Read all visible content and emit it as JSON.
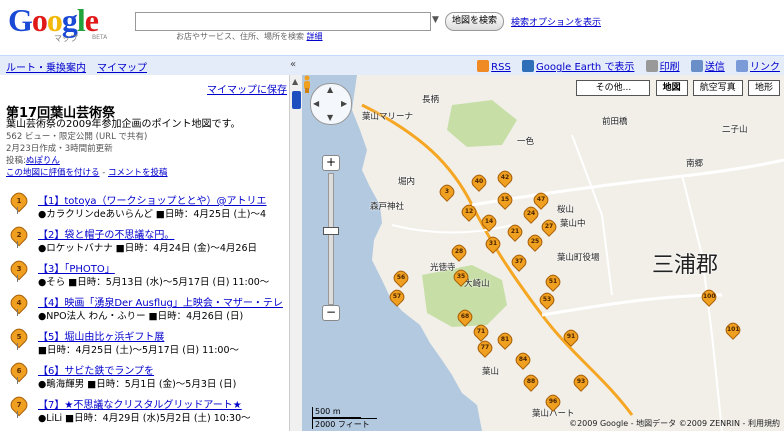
{
  "header": {
    "logo_text": "Google",
    "logo_sub": "マップ",
    "logo_beta": "BETA",
    "search_value": "",
    "search_button": "地図を検索",
    "search_options": "検索オプションを表示",
    "search_hint": "お店やサービス、住所、場所を検索",
    "search_hint_link": "詳細"
  },
  "topbar": {
    "tab_route": "ルート・乗換案内",
    "tab_mymaps": "マイマップ",
    "collapse_glyph": "«",
    "tools": {
      "rss": "RSS",
      "earth": "Google Earth で表示",
      "print": "印刷",
      "send": "送信",
      "link": "リンク"
    }
  },
  "sidebar": {
    "save_link": "マイマップに保存",
    "title": "第17回葉山芸術祭",
    "description": "葉山芸術祭の2009年参加企画のポイント地図です。",
    "stats": "562 ビュー・限定公開 (URL で共有)",
    "dates": "2月23日作成・3時間前更新",
    "author_label": "投稿:",
    "author": "ぬぽりん",
    "rate_link": "この地図に評価を付ける",
    "comment_link": "コメントを投稿",
    "comment_sep": " - ",
    "items": [
      {
        "num": "1",
        "title": "【1】totoya（ワークショップととや）@アトリエ",
        "detail": "●カラクリンdeあいらんど ■日時：4月25日 (土)〜4"
      },
      {
        "num": "2",
        "title": "【2】袋と帽子の不思議な円。",
        "detail": "●ロケットバナナ ■日時：4月24日 (金)〜4月26日"
      },
      {
        "num": "3",
        "title": "【3】「PHOTO」",
        "detail": "●そら ■日時：5月13日 (水)〜5月17日 (日) 11:00〜"
      },
      {
        "num": "4",
        "title": "【4】映画「湧泉Der Ausflug」上映会・マザー・テレ",
        "detail": "●NPO法人 わん・ふりー ■日時：4月26日 (日)"
      },
      {
        "num": "5",
        "title": "【5】堀山由比ヶ浜ギフト展",
        "detail": "■日時：4月25日 (土)〜5月17日 (日) 11:00〜"
      },
      {
        "num": "6",
        "title": "【6】サビた鉄でランプを",
        "detail": "●鴫海輝男 ■日時：5月1日 (金)〜5月3日 (日)"
      },
      {
        "num": "7",
        "title": "【7】★不思議なクリスタルグリッドアート★",
        "detail": "●LiLi ■日時：4月29日 (水)5月2日 (土) 10:30〜"
      }
    ]
  },
  "map": {
    "types": {
      "other": "その他...",
      "map": "地図",
      "aerial": "航空写真",
      "terrain": "地形"
    },
    "labels": {
      "miura": "三浦郡",
      "hayama": "葉山",
      "hayama_marina": "葉山マリーナ",
      "shrine": "森戸神社",
      "kojin": "光徳寺",
      "oosaki": "大崎山",
      "nagae": "長柄",
      "minamigo": "南郷",
      "sakurayama": "桜山",
      "hayama_jh": "葉山中",
      "town_office": "葉山町役場",
      "isshiki": "一色",
      "nisshiki": "二子山",
      "horiuchi": "堀内",
      "gate": "前田橋",
      "hayama_heart": "葉山ハート"
    },
    "pins": [
      "3",
      "12",
      "14",
      "15",
      "21",
      "24",
      "25",
      "27",
      "28",
      "31",
      "35",
      "37",
      "40",
      "42",
      "47",
      "51",
      "53",
      "56",
      "57",
      "68",
      "71",
      "77",
      "81",
      "84",
      "88",
      "91",
      "93",
      "96",
      "100",
      "101"
    ],
    "scale_m": "500 m",
    "scale_ft": "2000 フィート",
    "copyright": "©2009 Google - 地図データ ©2009 ZENRIN - 利用規約"
  },
  "colors": {
    "link": "#0000cc",
    "pin": "#f0a020",
    "bar": "#e5ecf9",
    "water": "#b3c9e0",
    "land": "#f2efe9",
    "park": "#c7dfa6"
  }
}
